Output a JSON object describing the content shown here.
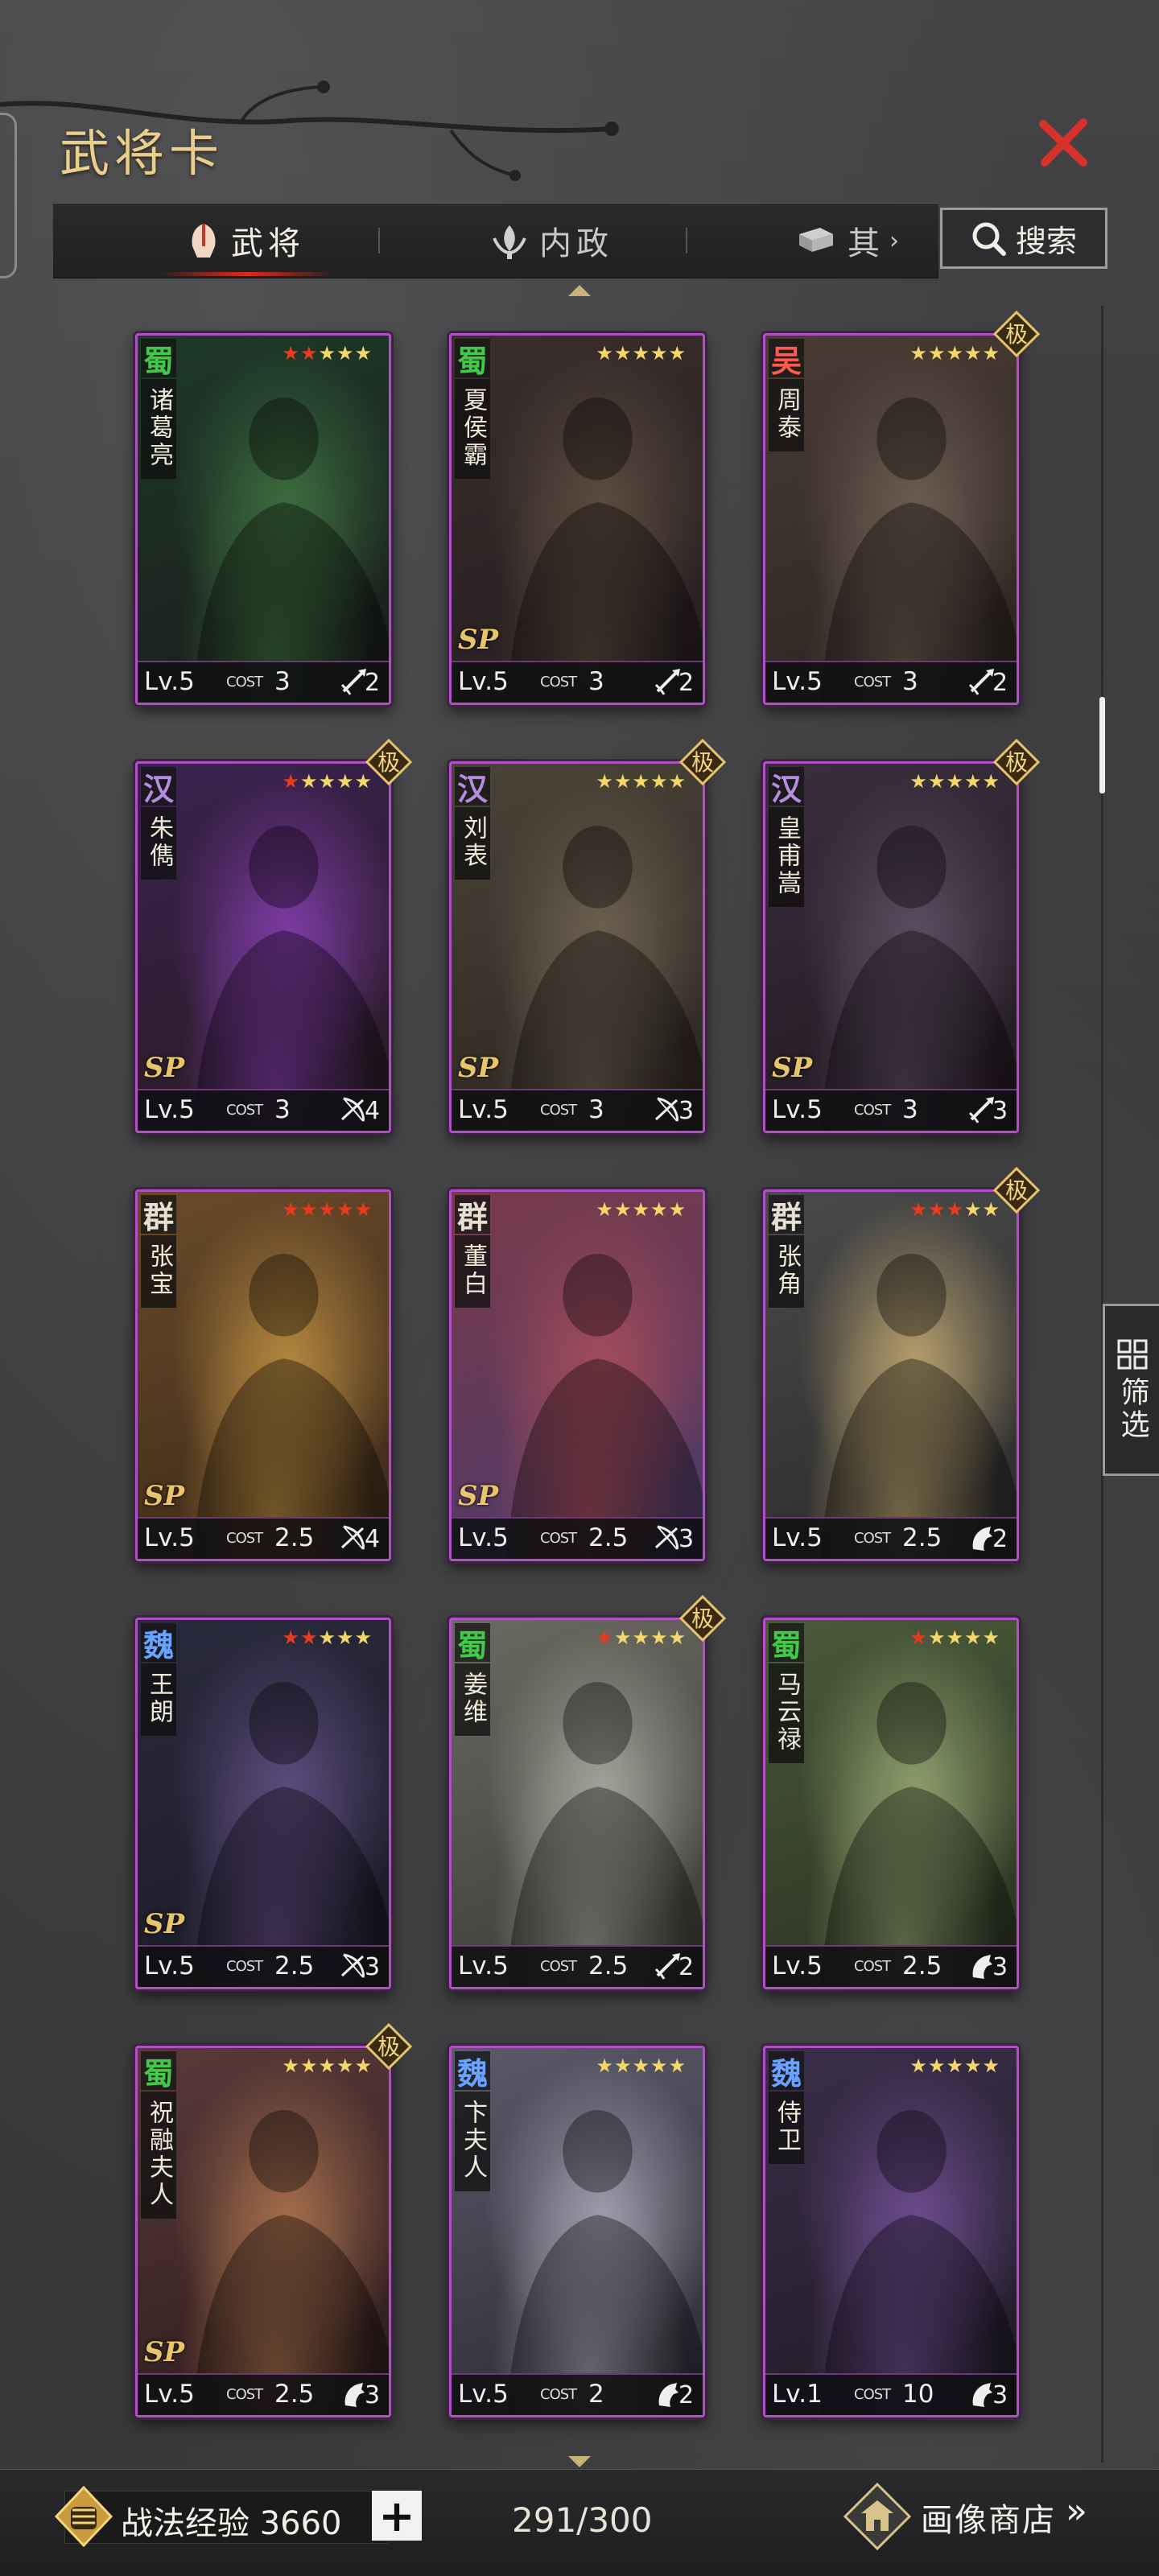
{
  "header": {
    "title": "武将卡",
    "close_icon": "close-icon"
  },
  "tabs": [
    {
      "label": "武将",
      "icon": "helmet-icon",
      "active": true
    },
    {
      "label": "内政",
      "icon": "lotus-icon",
      "active": false
    },
    {
      "label": "其",
      "icon": "book-icon",
      "active": false
    }
  ],
  "search": {
    "label": "搜索",
    "icon": "search-icon"
  },
  "filter": {
    "label": "筛选",
    "icon": "grid-icon"
  },
  "colors": {
    "shu": "#43c94a",
    "wu": "#ff5a4a",
    "han": "#b58de0",
    "qun": "#e6e0d0",
    "wei": "#6aa3ff",
    "frame": "#b14fc4"
  },
  "cards": [
    {
      "faction": "蜀",
      "faction_color": "#43c94a",
      "name": "诸葛亮",
      "red_stars": 2,
      "gold_stars": 3,
      "ji": false,
      "sp": false,
      "level": "Lv.5",
      "cost_label": "COST",
      "cost": "3",
      "unit_icon": "spear-icon",
      "unit": "2",
      "palette": [
        "#1d3a2a",
        "#3b6a3d",
        "#1a1a1a"
      ]
    },
    {
      "faction": "蜀",
      "faction_color": "#43c94a",
      "name": "夏侯霸",
      "red_stars": 0,
      "gold_stars": 5,
      "ji": false,
      "sp": true,
      "level": "Lv.5",
      "cost_label": "COST",
      "cost": "3",
      "unit_icon": "spear-icon",
      "unit": "2",
      "palette": [
        "#3a2e2c",
        "#5a4a3e",
        "#241c20"
      ]
    },
    {
      "faction": "吴",
      "faction_color": "#ff5a4a",
      "name": "周泰",
      "red_stars": 0,
      "gold_stars": 5,
      "ji": true,
      "sp": false,
      "level": "Lv.5",
      "cost_label": "COST",
      "cost": "3",
      "unit_icon": "spear-icon",
      "unit": "2",
      "palette": [
        "#4a3c34",
        "#6a5a50",
        "#2a2220"
      ]
    },
    {
      "faction": "汉",
      "faction_color": "#b58de0",
      "name": "朱儁",
      "red_stars": 1,
      "gold_stars": 4,
      "ji": true,
      "sp": true,
      "level": "Lv.5",
      "cost_label": "COST",
      "cost": "3",
      "unit_icon": "bow-icon",
      "unit": "4",
      "palette": [
        "#3a2250",
        "#7a3aa0",
        "#2a1a20"
      ]
    },
    {
      "faction": "汉",
      "faction_color": "#b58de0",
      "name": "刘表",
      "red_stars": 0,
      "gold_stars": 5,
      "ji": true,
      "sp": true,
      "level": "Lv.5",
      "cost_label": "COST",
      "cost": "3",
      "unit_icon": "bow-icon",
      "unit": "3",
      "palette": [
        "#4a4438",
        "#6a5e4e",
        "#2a2420"
      ]
    },
    {
      "faction": "汉",
      "faction_color": "#b58de0",
      "name": "皇甫嵩",
      "red_stars": 0,
      "gold_stars": 5,
      "ji": true,
      "sp": true,
      "level": "Lv.5",
      "cost_label": "COST",
      "cost": "3",
      "unit_icon": "spear-icon",
      "unit": "3",
      "palette": [
        "#3a2e3e",
        "#5a4a5e",
        "#20181e"
      ]
    },
    {
      "faction": "群",
      "faction_color": "#e6e0d0",
      "name": "张宝",
      "red_stars": 5,
      "gold_stars": 0,
      "ji": false,
      "sp": true,
      "level": "Lv.5",
      "cost_label": "COST",
      "cost": "2.5",
      "unit_icon": "bow-icon",
      "unit": "4",
      "palette": [
        "#6a4a2a",
        "#b0843e",
        "#3a2818"
      ]
    },
    {
      "faction": "群",
      "faction_color": "#e6e0d0",
      "name": "董白",
      "red_stars": 0,
      "gold_stars": 5,
      "ji": false,
      "sp": true,
      "level": "Lv.5",
      "cost_label": "COST",
      "cost": "2.5",
      "unit_icon": "bow-icon",
      "unit": "3",
      "palette": [
        "#7a3a4a",
        "#a04a5a",
        "#4a3a6a"
      ]
    },
    {
      "faction": "群",
      "faction_color": "#e6e0d0",
      "name": "张角",
      "red_stars": 3,
      "gold_stars": 2,
      "ji": true,
      "sp": false,
      "level": "Lv.5",
      "cost_label": "COST",
      "cost": "2.5",
      "unit_icon": "horse-icon",
      "unit": "2",
      "palette": [
        "#4a4a4a",
        "#b09a6a",
        "#2a2a2a"
      ]
    },
    {
      "faction": "魏",
      "faction_color": "#6aa3ff",
      "name": "王朗",
      "red_stars": 2,
      "gold_stars": 3,
      "ji": false,
      "sp": true,
      "level": "Lv.5",
      "cost_label": "COST",
      "cost": "2.5",
      "unit_icon": "bow-icon",
      "unit": "3",
      "palette": [
        "#2a2a3e",
        "#5a4a7a",
        "#1a1a24"
      ]
    },
    {
      "faction": "蜀",
      "faction_color": "#43c94a",
      "name": "姜维",
      "red_stars": 1,
      "gold_stars": 4,
      "ji": true,
      "sp": false,
      "level": "Lv.5",
      "cost_label": "COST",
      "cost": "2.5",
      "unit_icon": "spear-icon",
      "unit": "2",
      "palette": [
        "#6a6a62",
        "#a0a098",
        "#3a3a36"
      ]
    },
    {
      "faction": "蜀",
      "faction_color": "#43c94a",
      "name": "马云禄",
      "red_stars": 1,
      "gold_stars": 4,
      "ji": false,
      "sp": false,
      "level": "Lv.5",
      "cost_label": "COST",
      "cost": "2.5",
      "unit_icon": "horse-icon",
      "unit": "3",
      "palette": [
        "#4a5a3a",
        "#8a9a6a",
        "#2a3020"
      ]
    },
    {
      "faction": "蜀",
      "faction_color": "#43c94a",
      "name": "祝融夫人",
      "red_stars": 0,
      "gold_stars": 5,
      "ji": true,
      "sp": true,
      "level": "Lv.5",
      "cost_label": "COST",
      "cost": "2.5",
      "unit_icon": "horse-icon",
      "unit": "3",
      "palette": [
        "#5a3a3a",
        "#a06a4a",
        "#2a1a1a"
      ]
    },
    {
      "faction": "魏",
      "faction_color": "#6aa3ff",
      "name": "卞夫人",
      "red_stars": 0,
      "gold_stars": 5,
      "ji": false,
      "sp": false,
      "level": "Lv.5",
      "cost_label": "COST",
      "cost": "2",
      "unit_icon": "horse-icon",
      "unit": "2",
      "palette": [
        "#5a5a6a",
        "#9a9aa8",
        "#2a2a34"
      ]
    },
    {
      "faction": "魏",
      "faction_color": "#6aa3ff",
      "name": "侍卫",
      "red_stars": 0,
      "gold_stars": 5,
      "ji": false,
      "sp": false,
      "level": "Lv.1",
      "cost_label": "COST",
      "cost": "10",
      "unit_icon": "horse-icon",
      "unit": "3",
      "palette": [
        "#3a2e4a",
        "#6a4a8a",
        "#1e1a24"
      ]
    }
  ],
  "bottom": {
    "exp_label": "战法经验",
    "exp_value": "3660",
    "exp_text": "战法经验 3660",
    "plus": "+",
    "count": "291/300",
    "shop_label": "画像商店",
    "shop_arrow": "»"
  }
}
